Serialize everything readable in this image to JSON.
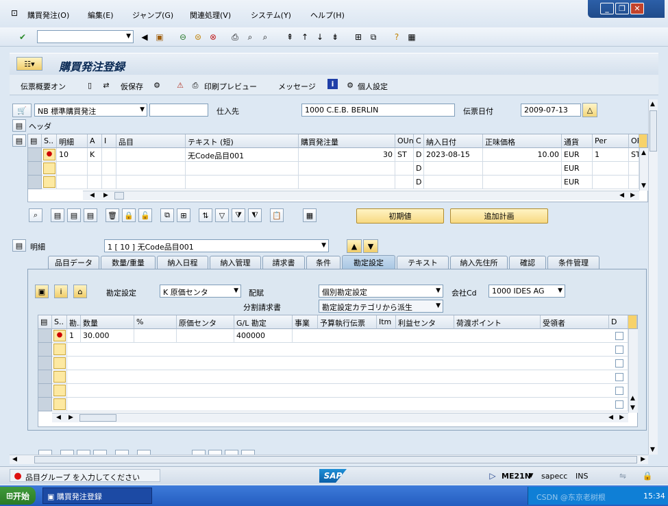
{
  "menubar": {
    "items": [
      "購買発注(O)",
      "編集(E)",
      "ジャンプ(G)",
      "関連処理(V)",
      "システム(Y)",
      "ヘルプ(H)"
    ]
  },
  "window": {
    "title": "購買発注登録"
  },
  "app_toolbar": {
    "doc_overview": "伝票概要オン",
    "hold": "仮保存",
    "print_preview": "印刷プレビュー",
    "messages": "メッセージ",
    "personal": "個人設定"
  },
  "header": {
    "doc_type": "NB 標準購買発注",
    "doc_type_extra": "",
    "vendor_label": "仕入先",
    "vendor_value": "1000 C.E.B. BERLIN",
    "doc_date_label": "伝票日付",
    "doc_date_value": "2009-07-13",
    "header_label": "ヘッダ"
  },
  "items_table": {
    "columns": [
      "S..",
      "明細",
      "A",
      "I",
      "品目",
      "テキスト (短)",
      "購買発注量",
      "OUn",
      "C",
      "納入日付",
      "正味価格",
      "通貨",
      "Per",
      "OP"
    ],
    "rows": [
      {
        "item": "10",
        "a": "K",
        "i": "",
        "material": "",
        "text": "无Code品目001",
        "qty": "30",
        "oun": "ST",
        "c": "D",
        "date": "2023-08-15",
        "price": "10.00",
        "currency": "EUR",
        "per": "1",
        "op": "ST"
      },
      {
        "item": "",
        "a": "",
        "i": "",
        "material": "",
        "text": "",
        "qty": "",
        "oun": "",
        "c": "D",
        "date": "",
        "price": "",
        "currency": "EUR",
        "per": "",
        "op": ""
      },
      {
        "item": "",
        "a": "",
        "i": "",
        "material": "",
        "text": "",
        "qty": "",
        "oun": "",
        "c": "D",
        "date": "",
        "price": "",
        "currency": "EUR",
        "per": "",
        "op": ""
      }
    ]
  },
  "item_buttons": {
    "defaults": "初期値",
    "additional_plan": "追加計画"
  },
  "item_detail": {
    "label": "明細",
    "selected": "1 [ 10 ] 无Code品目001"
  },
  "tabs": [
    "品目データ",
    "数量/重量",
    "納入日程",
    "納入管理",
    "請求書",
    "条件",
    "勘定設定",
    "テキスト",
    "納入先住所",
    "確認",
    "条件管理"
  ],
  "active_tab": "勘定設定",
  "account": {
    "acct_assign_label": "勘定設定",
    "acct_assign_value": "K 原価センタ",
    "distribution_label": "配賦",
    "distribution_value": "個別勘定設定",
    "company_label": "会社Cd",
    "company_value": "1000 IDES AG",
    "partial_invoice_label": "分割請求書",
    "partial_invoice_value": "勘定設定カテゴリから派生"
  },
  "acct_table": {
    "columns": [
      "S..",
      "勘..",
      "数量",
      "%",
      "原価センタ",
      "G/L 勘定",
      "事業",
      "予算執行伝票",
      "Itm",
      "利益センタ",
      "荷渡ポイント",
      "受領者",
      "D"
    ],
    "rows": [
      {
        "no": "1",
        "qty": "30.000",
        "pct": "",
        "cost_center": "",
        "gl": "400000"
      }
    ]
  },
  "status": {
    "message": "品目グループ を入力してください",
    "sap_logo": "SAP",
    "tcode": "ME21N",
    "server": "sapecc",
    "mode": "INS"
  },
  "taskbar": {
    "start": "开始",
    "task": "購買発注登録",
    "watermark": "CSDN @东京老树根",
    "clock": "15:34"
  },
  "colors": {
    "accent": "#0a2a55",
    "tab_active": "#a9c7e3",
    "button_yellow": "#f7d982"
  }
}
